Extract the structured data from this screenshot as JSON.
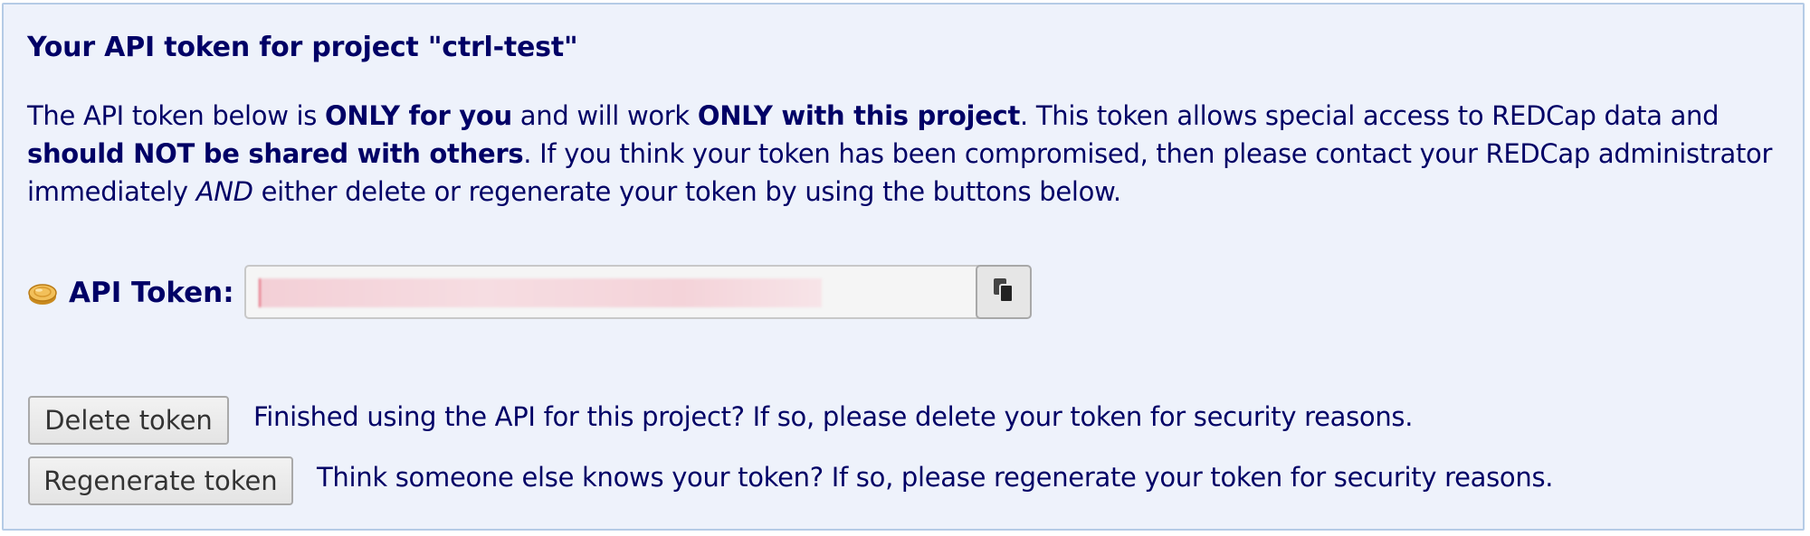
{
  "title": "Your API token for project \"ctrl-test\"",
  "intro": {
    "p1": "The API token below is ",
    "b1": "ONLY for you",
    "p2": " and will work ",
    "b2": "ONLY with this project",
    "p3": ". This token allows special access to REDCap data and ",
    "b3": "should NOT be shared with others",
    "p4": ". If you think your token has been compromised, then please contact your REDCap administrator immediately ",
    "i1": "AND",
    "p5": " either delete or regenerate your token by using the buttons below."
  },
  "token": {
    "label": "API Token:",
    "icon": "coin-icon",
    "value_redacted": true,
    "copy_icon": "clipboard-icon"
  },
  "actions": {
    "delete_label": "Delete token",
    "delete_desc": "Finished using the API for this project? If so, please delete your token for security reasons.",
    "regen_label": "Regenerate token",
    "regen_desc": "Think someone else knows your token? If so, please regenerate your token for security reasons."
  },
  "colors": {
    "text": "#000066",
    "panel_bg": "#eef2fb",
    "panel_border": "#b5cbe6",
    "button_bg": "#e6e6e6"
  }
}
